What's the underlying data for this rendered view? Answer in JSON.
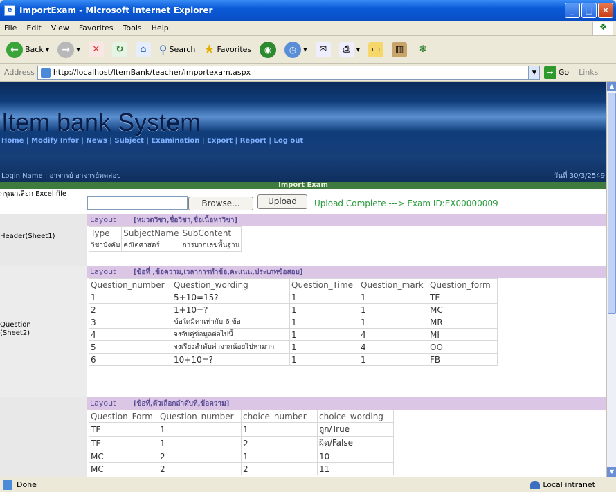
{
  "window": {
    "title": "ImportExam - Microsoft Internet Explorer"
  },
  "menu": [
    "File",
    "Edit",
    "View",
    "Favorites",
    "Tools",
    "Help"
  ],
  "toolbar": {
    "back": "Back",
    "search": "Search",
    "favorites": "Favorites"
  },
  "address": {
    "label": "Address",
    "url": "http://localhost/ItemBank/teacher/importexam.aspx",
    "go": "Go",
    "links": "Links"
  },
  "site": {
    "title": "Item bank System",
    "nav": [
      "Home",
      "Modify Infor",
      "News",
      "Subject",
      "Examination",
      "Export",
      "Report",
      "Log out"
    ],
    "login_label": "Login Name : อาจารย์ อาจารย์ทดสอบ",
    "date": "วันที่ 30/3/2549",
    "section_title": "Import Exam"
  },
  "upload": {
    "label": "กรุณาเลือก Excel file",
    "browse": "Browse...",
    "upload": "Upload",
    "message": "Upload Complete ---> Exam ID:EX00000009"
  },
  "header_sheet": {
    "label": "Header(Sheet1)",
    "layout_key": "Layout",
    "layout_value": "[หมวดวิชา,ชื่อวิชา,ชื่อเนื้อหาวิชา]",
    "rows": [
      [
        "Type",
        "SubjectName",
        "SubContent"
      ],
      [
        "วิชาบังคับ",
        "คณิตศาสตร์",
        "การบวกเลขพื้นฐาน"
      ]
    ]
  },
  "question_sheet": {
    "label": "Question (Sheet2)",
    "layout_key": "Layout",
    "layout_value": "[ข้อที่ ,ข้อความ,เวลาการทำข้อ,คะแนน,ประเภทข้อสอบ]",
    "rows": [
      [
        "Question_number",
        "Question_wording",
        "Question_Time",
        "Question_mark",
        "Question_form"
      ],
      [
        "1",
        "5+10=15?",
        "1",
        "1",
        "TF"
      ],
      [
        "2",
        "1+10=?",
        "1",
        "1",
        "MC"
      ],
      [
        "3",
        "ข้อใดมีค่าเท่ากับ 6 ข้อ",
        "1",
        "1",
        "MR"
      ],
      [
        "4",
        "จงจับคู่ข้อมูลต่อไปนี้",
        "1",
        "4",
        "MI"
      ],
      [
        "5",
        "จงเรียงลำดับค่าจากน้อยไปหามาก",
        "1",
        "4",
        "OO"
      ],
      [
        "6",
        "10+10=?",
        "1",
        "1",
        "FB"
      ]
    ]
  },
  "choice_sheet": {
    "layout_key": "Layout",
    "layout_value": "[ข้อที่,ตัวเลือกลำดับที่,ข้อความ]",
    "rows": [
      [
        "Question_Form",
        "Question_number",
        "choice_number",
        "choice_wording"
      ],
      [
        "TF",
        "1",
        "1",
        "ถูก/True"
      ],
      [
        "TF",
        "1",
        "2",
        "ผิด/False"
      ],
      [
        "MC",
        "2",
        "1",
        "10"
      ],
      [
        "MC",
        "2",
        "2",
        "11"
      ]
    ]
  },
  "status": {
    "left": "Done",
    "zone": "Local intranet"
  }
}
